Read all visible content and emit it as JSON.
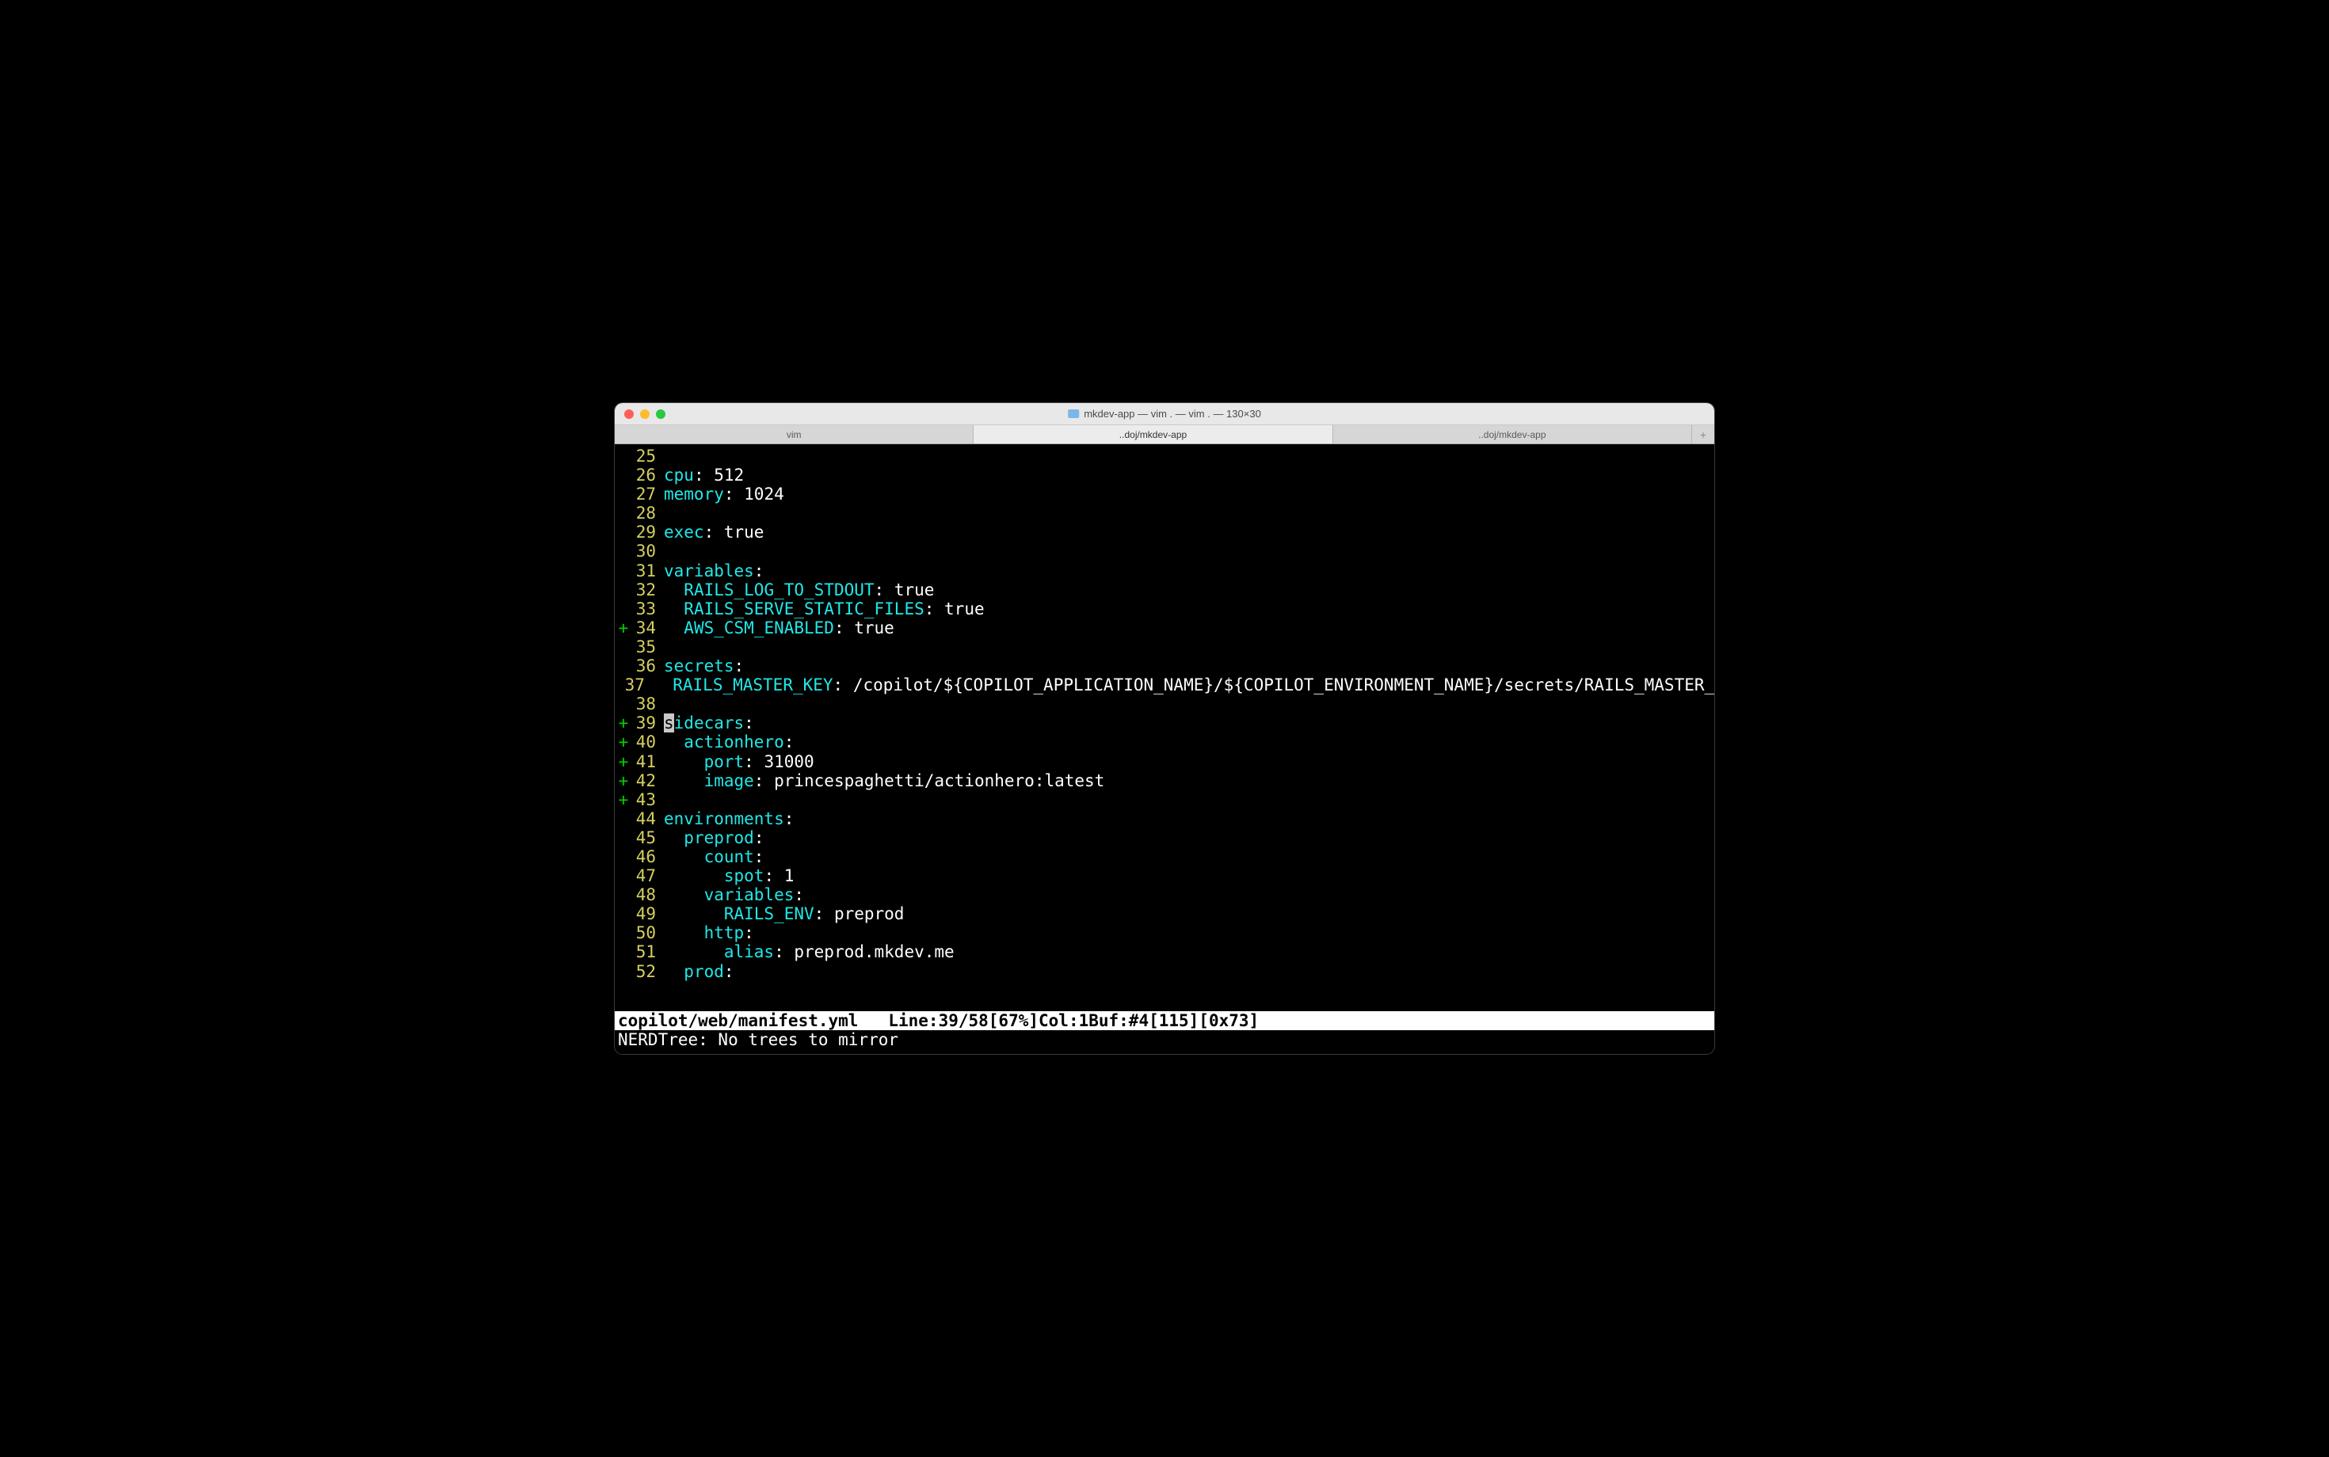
{
  "window": {
    "title": "mkdev-app — vim . — vim . — 130×30"
  },
  "tabs": [
    {
      "label": "vim",
      "active": false
    },
    {
      "label": "..doj/mkdev-app",
      "active": true
    },
    {
      "label": "..doj/mkdev-app",
      "active": false
    }
  ],
  "lines": [
    {
      "num": "25",
      "sign": "",
      "segments": []
    },
    {
      "num": "26",
      "sign": "",
      "segments": [
        {
          "t": "cpu",
          "c": "key"
        },
        {
          "t": ": ",
          "c": "val"
        },
        {
          "t": "512",
          "c": "val"
        }
      ]
    },
    {
      "num": "27",
      "sign": "",
      "segments": [
        {
          "t": "memory",
          "c": "key"
        },
        {
          "t": ": ",
          "c": "val"
        },
        {
          "t": "1024",
          "c": "val"
        }
      ]
    },
    {
      "num": "28",
      "sign": "",
      "segments": []
    },
    {
      "num": "29",
      "sign": "",
      "segments": [
        {
          "t": "exec",
          "c": "key"
        },
        {
          "t": ": ",
          "c": "val"
        },
        {
          "t": "true",
          "c": "val"
        }
      ]
    },
    {
      "num": "30",
      "sign": "",
      "segments": []
    },
    {
      "num": "31",
      "sign": "",
      "segments": [
        {
          "t": "variables",
          "c": "key"
        },
        {
          "t": ":",
          "c": "val"
        }
      ]
    },
    {
      "num": "32",
      "sign": "",
      "segments": [
        {
          "t": "  ",
          "c": "val"
        },
        {
          "t": "RAILS_LOG_TO_STDOUT",
          "c": "key"
        },
        {
          "t": ": ",
          "c": "val"
        },
        {
          "t": "true",
          "c": "val"
        }
      ]
    },
    {
      "num": "33",
      "sign": "",
      "segments": [
        {
          "t": "  ",
          "c": "val"
        },
        {
          "t": "RAILS_SERVE_STATIC_FILES",
          "c": "key"
        },
        {
          "t": ": ",
          "c": "val"
        },
        {
          "t": "true",
          "c": "val"
        }
      ]
    },
    {
      "num": "34",
      "sign": "+",
      "segments": [
        {
          "t": "  ",
          "c": "val"
        },
        {
          "t": "AWS_CSM_ENABLED",
          "c": "key"
        },
        {
          "t": ": ",
          "c": "val"
        },
        {
          "t": "true",
          "c": "val"
        }
      ]
    },
    {
      "num": "35",
      "sign": "",
      "segments": []
    },
    {
      "num": "36",
      "sign": "",
      "segments": [
        {
          "t": "secrets",
          "c": "key"
        },
        {
          "t": ":",
          "c": "val"
        }
      ]
    },
    {
      "num": "37",
      "sign": "",
      "segments": [
        {
          "t": "  ",
          "c": "val"
        },
        {
          "t": "RAILS_MASTER_KEY",
          "c": "key"
        },
        {
          "t": ": ",
          "c": "val"
        },
        {
          "t": "/copilot/${COPILOT_APPLICATION_NAME}/${COPILOT_ENVIRONMENT_NAME}/secrets/RAILS_MASTER_KEY",
          "c": "val"
        }
      ]
    },
    {
      "num": "38",
      "sign": "",
      "segments": []
    },
    {
      "num": "39",
      "sign": "+",
      "cursor": true,
      "segments": [
        {
          "t": "s",
          "c": "cursor-char"
        },
        {
          "t": "idecars",
          "c": "key"
        },
        {
          "t": ":",
          "c": "val"
        }
      ]
    },
    {
      "num": "40",
      "sign": "+",
      "segments": [
        {
          "t": "  ",
          "c": "val"
        },
        {
          "t": "actionhero",
          "c": "key"
        },
        {
          "t": ":",
          "c": "val"
        }
      ]
    },
    {
      "num": "41",
      "sign": "+",
      "segments": [
        {
          "t": "    ",
          "c": "val"
        },
        {
          "t": "port",
          "c": "key"
        },
        {
          "t": ": ",
          "c": "val"
        },
        {
          "t": "31000",
          "c": "val"
        }
      ]
    },
    {
      "num": "42",
      "sign": "+",
      "segments": [
        {
          "t": "    ",
          "c": "val"
        },
        {
          "t": "image",
          "c": "key"
        },
        {
          "t": ": ",
          "c": "val"
        },
        {
          "t": "princespaghetti/actionhero:latest",
          "c": "val"
        }
      ]
    },
    {
      "num": "43",
      "sign": "+",
      "segments": []
    },
    {
      "num": "44",
      "sign": "",
      "segments": [
        {
          "t": "environments",
          "c": "key"
        },
        {
          "t": ":",
          "c": "val"
        }
      ]
    },
    {
      "num": "45",
      "sign": "",
      "segments": [
        {
          "t": "  ",
          "c": "val"
        },
        {
          "t": "preprod",
          "c": "key"
        },
        {
          "t": ":",
          "c": "val"
        }
      ]
    },
    {
      "num": "46",
      "sign": "",
      "segments": [
        {
          "t": "    ",
          "c": "val"
        },
        {
          "t": "count",
          "c": "key"
        },
        {
          "t": ":",
          "c": "val"
        }
      ]
    },
    {
      "num": "47",
      "sign": "",
      "segments": [
        {
          "t": "      ",
          "c": "val"
        },
        {
          "t": "spot",
          "c": "key"
        },
        {
          "t": ": ",
          "c": "val"
        },
        {
          "t": "1",
          "c": "val"
        }
      ]
    },
    {
      "num": "48",
      "sign": "",
      "segments": [
        {
          "t": "    ",
          "c": "val"
        },
        {
          "t": "variables",
          "c": "key"
        },
        {
          "t": ":",
          "c": "val"
        }
      ]
    },
    {
      "num": "49",
      "sign": "",
      "segments": [
        {
          "t": "      ",
          "c": "val"
        },
        {
          "t": "RAILS_ENV",
          "c": "key"
        },
        {
          "t": ": ",
          "c": "val"
        },
        {
          "t": "preprod",
          "c": "val"
        }
      ]
    },
    {
      "num": "50",
      "sign": "",
      "segments": [
        {
          "t": "    ",
          "c": "val"
        },
        {
          "t": "http",
          "c": "key"
        },
        {
          "t": ":",
          "c": "val"
        }
      ]
    },
    {
      "num": "51",
      "sign": "",
      "segments": [
        {
          "t": "      ",
          "c": "val"
        },
        {
          "t": "alias",
          "c": "key"
        },
        {
          "t": ": ",
          "c": "val"
        },
        {
          "t": "preprod.mkdev.me",
          "c": "val"
        }
      ]
    },
    {
      "num": "52",
      "sign": "",
      "segments": [
        {
          "t": "  ",
          "c": "val"
        },
        {
          "t": "prod",
          "c": "key"
        },
        {
          "t": ":",
          "c": "val"
        }
      ]
    }
  ],
  "statusline": "copilot/web/manifest.yml   Line:39/58[67%]Col:1Buf:#4[115][0x73]",
  "cmdline": "NERDTree: No trees to mirror"
}
